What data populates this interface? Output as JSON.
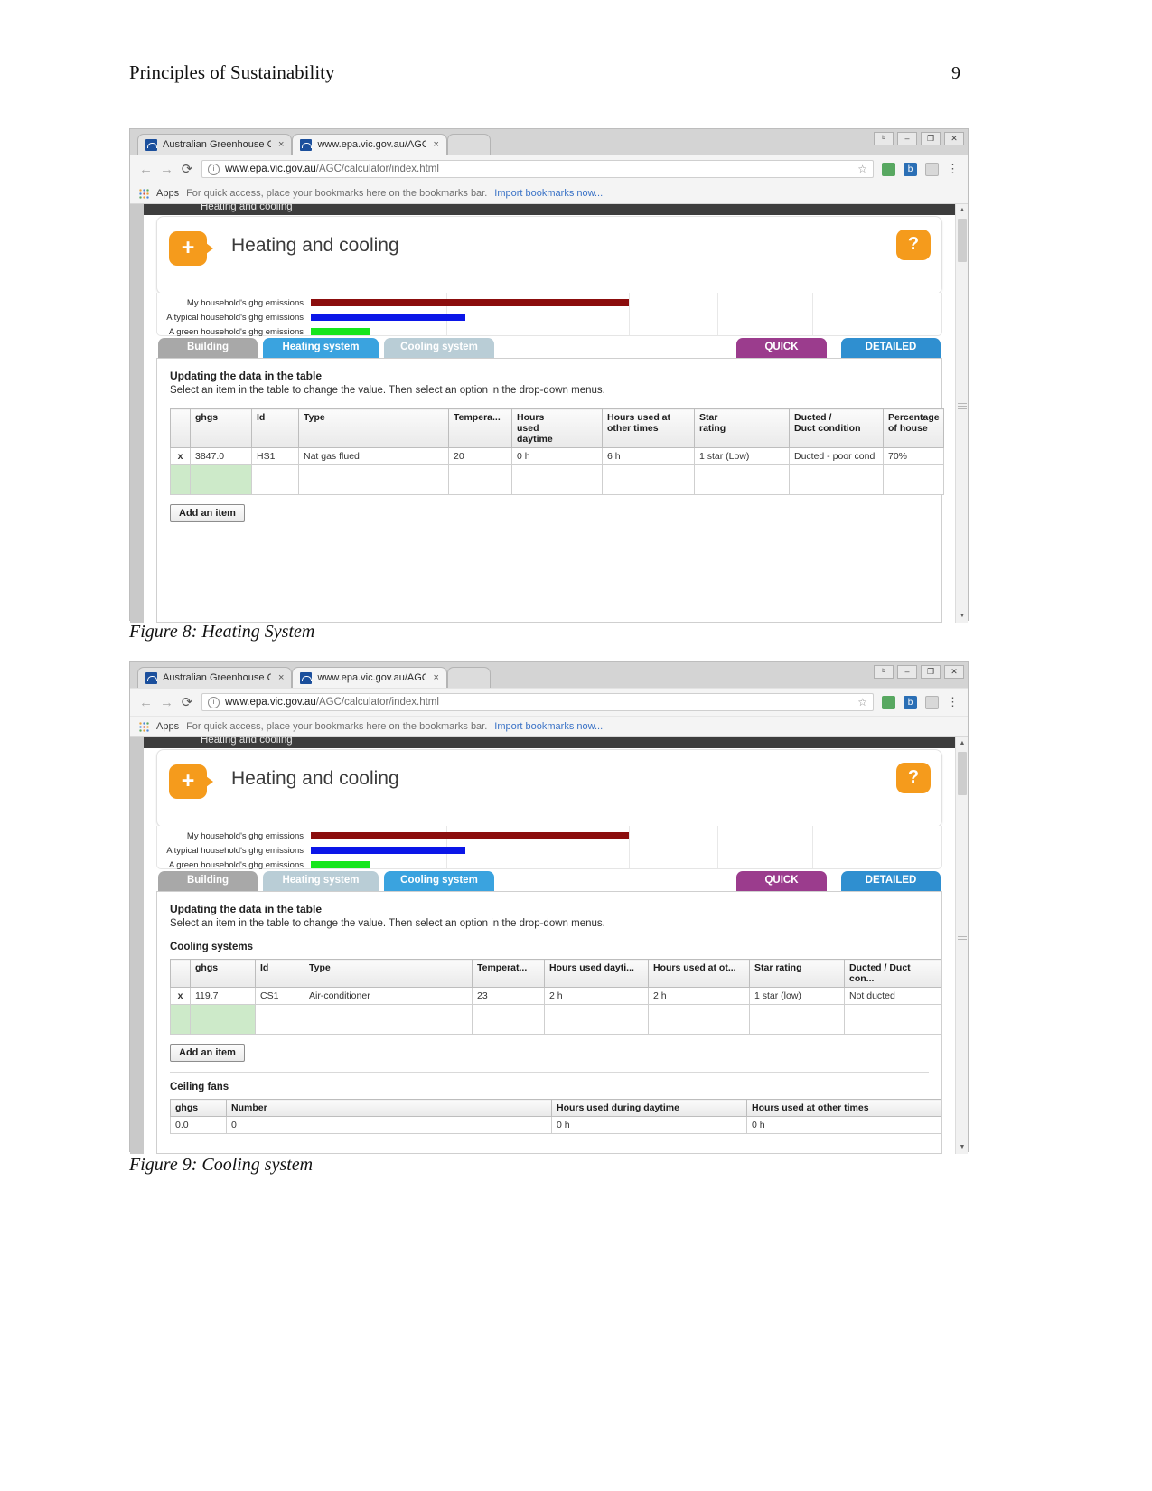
{
  "document": {
    "title": "Principles of Sustainability",
    "page_number": "9"
  },
  "captions": {
    "figure8": "Figure 8: Heating System",
    "figure9": "Figure 9: Cooling system"
  },
  "browser": {
    "tabs": [
      {
        "label": "Australian Greenhouse C",
        "close": "×",
        "state": "inactive"
      },
      {
        "label": "www.epa.vic.gov.au/AGC",
        "close": "×",
        "state": "active"
      }
    ],
    "window_buttons": [
      "ᵇ",
      "–",
      "❐",
      "✕"
    ],
    "nav": {
      "back": "←",
      "forward": "→",
      "reload": "⟳"
    },
    "url": {
      "info_icon": "i",
      "prefix": "www.epa.vic.gov.au",
      "path": "/AGC/calculator/index.html",
      "star": "☆"
    },
    "extensions": [
      "green-extension-icon",
      "b-extension-icon",
      "eye-extension-icon"
    ],
    "menu": "⋮",
    "bookmarks": {
      "apps_label": "Apps",
      "hint": "For quick access, place your bookmarks here on the bookmarks bar.",
      "import_link": "Import bookmarks now..."
    }
  },
  "app": {
    "dark_bar_text": "Heating and cooling",
    "panel_title": "Heating and cooling",
    "plus_label": "+",
    "help_label": "?",
    "tabs": [
      {
        "label": "Building",
        "style": "grey"
      },
      {
        "label": "Heating system",
        "style": "blue"
      },
      {
        "label": "Cooling system",
        "style": "lightblue"
      }
    ],
    "tabs_fig9": [
      {
        "label": "Building",
        "style": "grey"
      },
      {
        "label": "Heating system",
        "style": "lightblue"
      },
      {
        "label": "Cooling system",
        "style": "blue"
      }
    ],
    "mode_tabs": [
      {
        "label": "QUICK",
        "style": "purple"
      },
      {
        "label": "DETAILED",
        "style": "dblue"
      }
    ],
    "instructions": {
      "heading": "Updating the data in the table",
      "body": "Select an item in the table to change the value. Then select an option in the drop-down menus."
    },
    "add_item_label": "Add an item",
    "row_delete_label": "x"
  },
  "chart_data": {
    "type": "bar",
    "orientation": "horizontal",
    "title": "",
    "categories": [
      "My household's ghg emissions",
      "A typical household's ghg emissions",
      "A green household's ghg emissions"
    ],
    "values": [
      50.5,
      24.5,
      9.5
    ],
    "colors": [
      "#8b0d0d",
      "#0b16e8",
      "#16e61c"
    ],
    "xlabel": "",
    "ylabel": "",
    "xlim": [
      0,
      100
    ],
    "gridlines": [
      21.5,
      50.5,
      64.5,
      79.5
    ],
    "grid": true,
    "legend": "none"
  },
  "heating_table": {
    "headers": [
      "",
      "ghgs",
      "Id",
      "Type",
      "Tempera...",
      "Hours\nused\ndaytime",
      "Hours used at\nother times",
      "Star\nrating",
      "Ducted /\nDuct condition",
      "Percentage\nof house"
    ],
    "rows": [
      [
        "x",
        "3847.0",
        "HS1",
        "Nat gas flued",
        "20",
        "0 h",
        "6 h",
        "1 star (Low)",
        "Ducted - poor cond",
        "70%"
      ]
    ]
  },
  "cooling_section": {
    "cooling_label": "Cooling systems",
    "headers": [
      "",
      "ghgs",
      "Id",
      "Type",
      "Temperat...",
      "Hours used dayti...",
      "Hours used at ot...",
      "Star rating",
      "Ducted / Duct con..."
    ],
    "rows": [
      [
        "x",
        "119.7",
        "CS1",
        "Air-conditioner",
        "23",
        "2 h",
        "2 h",
        "1 star (low)",
        "Not ducted"
      ]
    ],
    "fans_label": "Ceiling fans",
    "fans_headers": [
      "ghgs",
      "Number",
      "Hours used during daytime",
      "Hours used at other times"
    ],
    "fans_rows": [
      [
        "0.0",
        "0",
        "0 h",
        "0 h"
      ]
    ]
  },
  "colors": {
    "accent_orange": "#f59b1c",
    "tab_blue": "#3aa3df",
    "quick_purple": "#9b3c8d",
    "value_yellow": "#fbf4c8",
    "ghg_green": "#cdeac9"
  }
}
